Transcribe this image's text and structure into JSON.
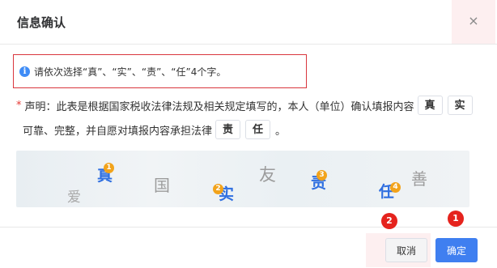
{
  "dialog": {
    "title": "信息确认",
    "close_label": "×"
  },
  "notice": {
    "text": "请依次选择“真”、“实”、“责”、“任”4个字。"
  },
  "declaration": {
    "required_mark": "*",
    "text1": "声明：此表是根据国家税收法律法规及相关规定填写的，本人（单位）确认填报内容",
    "chips1": [
      "真",
      "实"
    ],
    "text2": "可靠、完整，并自愿对填报内容承担法律",
    "chips2": [
      "责",
      "任"
    ],
    "end": "。"
  },
  "captcha": {
    "chars": [
      "真",
      "爱",
      "国",
      "实",
      "友",
      "责",
      "任",
      "善"
    ],
    "markers": [
      "1",
      "2",
      "3",
      "4"
    ]
  },
  "footer": {
    "cancel_label": "取消",
    "ok_label": "确定"
  },
  "annotations": {
    "badge1": "1",
    "badge2": "2"
  },
  "colors": {
    "primary": "#3f7ff0",
    "highlight_border": "#d9363e",
    "marker": "#f2a31b",
    "badge": "#e5231d"
  }
}
